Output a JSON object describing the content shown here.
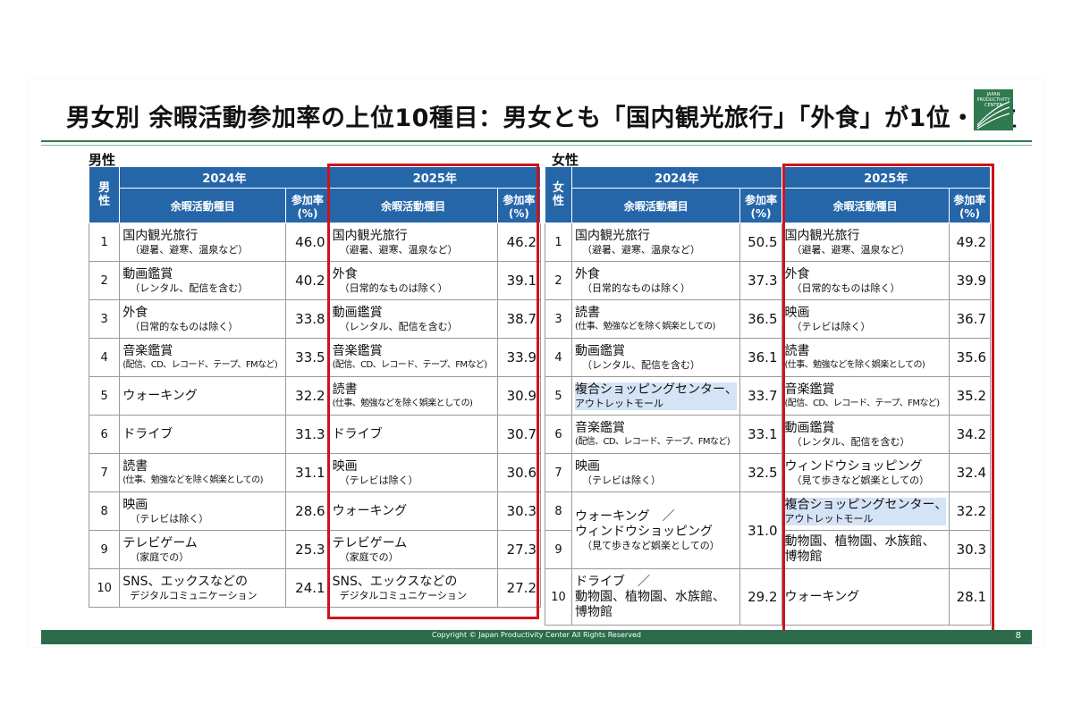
{
  "title": "男女別 余暇活動参加率の上位10種目：男女とも「国内観光旅行」「外食」が1位・2位",
  "logo_text": "JAPAN PRODUCTIVITY CENTER",
  "copyright": "Copyright © Japan Productivity Center All Rights Reserved",
  "page_number": "8",
  "male": {
    "label": "男性",
    "gender_header": "男性",
    "year_a": "2024年",
    "year_b": "2025年",
    "col_activity": "余暇活動種目",
    "col_rate": "参加率(%)",
    "rows": [
      {
        "rank": "1",
        "a_main": "国内観光旅行",
        "a_sub": "（避暑、避寒、温泉など）",
        "a_val": "46.0",
        "b_main": "国内観光旅行",
        "b_sub": "（避暑、避寒、温泉など）",
        "b_val": "46.2"
      },
      {
        "rank": "2",
        "a_main": "動画鑑賞",
        "a_sub": "（レンタル、配信を含む）",
        "a_val": "40.2",
        "b_main": "外食",
        "b_sub": "（日常的なものは除く）",
        "b_val": "39.1"
      },
      {
        "rank": "3",
        "a_main": "外食",
        "a_sub": "（日常的なものは除く）",
        "a_val": "33.8",
        "b_main": "動画鑑賞",
        "b_sub": "（レンタル、配信を含む）",
        "b_val": "38.7"
      },
      {
        "rank": "4",
        "a_main": "音楽鑑賞",
        "a_sub": "(配信、CD、レコード、テープ、FMなど)",
        "a_val": "33.5",
        "b_main": "音楽鑑賞",
        "b_sub": "(配信、CD、レコード、テープ、FMなど)",
        "b_val": "33.9"
      },
      {
        "rank": "5",
        "a_main": "ウォーキング",
        "a_sub": "",
        "a_val": "32.2",
        "b_main": "読書",
        "b_sub": "(仕事、勉強などを除く娯楽としての)",
        "b_val": "30.9"
      },
      {
        "rank": "6",
        "a_main": "ドライブ",
        "a_sub": "",
        "a_val": "31.3",
        "b_main": "ドライブ",
        "b_sub": "",
        "b_val": "30.7"
      },
      {
        "rank": "7",
        "a_main": "読書",
        "a_sub": "(仕事、勉強などを除く娯楽としての)",
        "a_val": "31.1",
        "b_main": "映画",
        "b_sub": "（テレビは除く）",
        "b_val": "30.6"
      },
      {
        "rank": "8",
        "a_main": "映画",
        "a_sub": "（テレビは除く）",
        "a_val": "28.6",
        "b_main": "ウォーキング",
        "b_sub": "",
        "b_val": "30.3"
      },
      {
        "rank": "9",
        "a_main": "テレビゲーム",
        "a_sub": "（家庭での）",
        "a_val": "25.3",
        "b_main": "テレビゲーム",
        "b_sub": "（家庭での）",
        "b_val": "27.3"
      },
      {
        "rank": "10",
        "a_main": "SNS、エックスなどの",
        "a_sub": "デジタルコミュニケーション",
        "a_val": "24.1",
        "b_main": "SNS、エックスなどの",
        "b_sub": "デジタルコミュニケーション",
        "b_val": "27.2"
      }
    ]
  },
  "female": {
    "label": "女性",
    "gender_header": "女性",
    "year_a": "2024年",
    "year_b": "2025年",
    "col_activity": "余暇活動種目",
    "col_rate": "参加率(%)",
    "rows": [
      {
        "rank": "1",
        "a_main": "国内観光旅行",
        "a_sub": "（避暑、避寒、温泉など）",
        "a_val": "50.5",
        "b_main": "国内観光旅行",
        "b_sub": "（避暑、避寒、温泉など）",
        "b_val": "49.2"
      },
      {
        "rank": "2",
        "a_main": "外食",
        "a_sub": "（日常的なものは除く）",
        "a_val": "37.3",
        "b_main": "外食",
        "b_sub": "（日常的なものは除く）",
        "b_val": "39.9"
      },
      {
        "rank": "3",
        "a_main": "読書",
        "a_sub": "(仕事、勉強などを除く娯楽としての)",
        "a_val": "36.5",
        "b_main": "映画",
        "b_sub": "（テレビは除く）",
        "b_val": "36.7"
      },
      {
        "rank": "4",
        "a_main": "動画鑑賞",
        "a_sub": "（レンタル、配信を含む）",
        "a_val": "36.1",
        "b_main": "読書",
        "b_sub": "(仕事、勉強などを除く娯楽としての)",
        "b_val": "35.6"
      },
      {
        "rank": "5",
        "a_main": "複合ショッピングセンター、",
        "a_sub": "アウトレットモール",
        "a_val": "33.7",
        "b_main": "音楽鑑賞",
        "b_sub": "(配信、CD、レコード、テープ、FMなど)",
        "b_val": "35.2"
      },
      {
        "rank": "6",
        "a_main": "音楽鑑賞",
        "a_sub": "(配信、CD、レコード、テープ、FMなど)",
        "a_val": "33.1",
        "b_main": "動画鑑賞",
        "b_sub": "（レンタル、配信を含む）",
        "b_val": "34.2"
      },
      {
        "rank": "7",
        "a_main": "映画",
        "a_sub": "（テレビは除く）",
        "a_val": "32.5",
        "b_main": "ウィンドウショッピング",
        "b_sub": "（見て歩きなど娯楽としての）",
        "b_val": "32.4"
      },
      {
        "rank": "8",
        "b_main": "複合ショッピングセンター、",
        "b_sub": "アウトレットモール",
        "b_val": "32.2"
      },
      {
        "rank": "9",
        "b_main": "動物園、植物園、水族館、",
        "b_sub": "博物館",
        "b_val": "30.3"
      },
      {
        "rank": "10",
        "a_main": "ドライブ　／",
        "a_sub": "動物園、植物園、水族館、博物館",
        "a_val": "29.2",
        "b_main": "ウォーキング",
        "b_sub": "",
        "b_val": "28.1"
      }
    ],
    "merged_8_9": {
      "line1": "ウォーキング　／",
      "line2": "ウィンドウショッピング",
      "line3": "（見て歩きなど娯楽としての）",
      "val": "31.0"
    }
  }
}
